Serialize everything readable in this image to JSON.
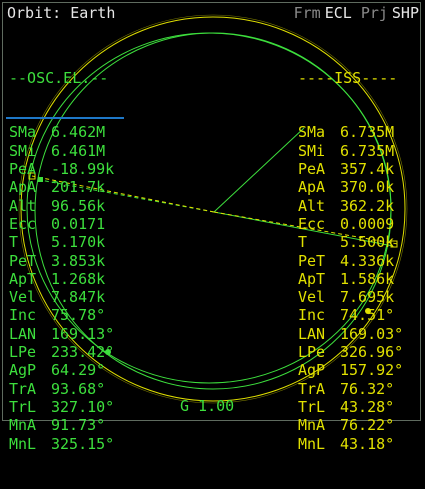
{
  "header": {
    "title": "Orbit: Earth",
    "frm_label": "Frm",
    "frm_value": "ECL",
    "prj_label": "Prj",
    "prj_value": "SHP"
  },
  "left_panel": {
    "section": "--OSC.EL.--",
    "rows": [
      {
        "label": "SMa",
        "value": "6.462M"
      },
      {
        "label": "SMi",
        "value": "6.461M"
      },
      {
        "label": "PeA",
        "value": "-18.99k"
      },
      {
        "label": "ApA",
        "value": "201.7k"
      },
      {
        "label": "Alt",
        "value": "96.56k"
      },
      {
        "label": "Ecc",
        "value": "0.0171"
      },
      {
        "label": "T",
        "value": "5.170k"
      },
      {
        "label": "PeT",
        "value": "3.853k"
      },
      {
        "label": "ApT",
        "value": "1.268k"
      },
      {
        "label": "Vel",
        "value": "7.847k"
      },
      {
        "label": "Inc",
        "value": "75.78°"
      },
      {
        "label": "LAN",
        "value": "169.13°"
      },
      {
        "label": "LPe",
        "value": "233.42°"
      },
      {
        "label": "AgP",
        "value": "64.29°"
      },
      {
        "label": "TrA",
        "value": "93.68°"
      },
      {
        "label": "TrL",
        "value": "327.10°"
      },
      {
        "label": "MnA",
        "value": "91.73°"
      },
      {
        "label": "MnL",
        "value": "325.15°"
      }
    ]
  },
  "right_panel": {
    "section": "----ISS----",
    "rows": [
      {
        "label": "SMa",
        "value": "6.735M"
      },
      {
        "label": "SMi",
        "value": "6.735M"
      },
      {
        "label": "PeA",
        "value": "357.4k"
      },
      {
        "label": "ApA",
        "value": "370.0k"
      },
      {
        "label": "Alt",
        "value": "362.2k"
      },
      {
        "label": "Ecc",
        "value": "0.0009"
      },
      {
        "label": "T",
        "value": "5.500k"
      },
      {
        "label": "PeT",
        "value": "4.336k"
      },
      {
        "label": "ApT",
        "value": "1.586k"
      },
      {
        "label": "Vel",
        "value": "7.695k"
      },
      {
        "label": "Inc",
        "value": "74.51°"
      },
      {
        "label": "LAN",
        "value": "169.03°"
      },
      {
        "label": "LPe",
        "value": "326.96°"
      },
      {
        "label": "AgP",
        "value": "157.92°"
      },
      {
        "label": "TrA",
        "value": "76.32°"
      },
      {
        "label": "TrL",
        "value": "43.28°"
      },
      {
        "label": "MnA",
        "value": "76.22°"
      },
      {
        "label": "MnL",
        "value": "43.18°"
      }
    ]
  },
  "footer": {
    "g_scale": "G 1.00"
  },
  "colors": {
    "own_orbit": "#3ddf3d",
    "target_orbit": "#e0e000",
    "planet": "#3ddf3d",
    "highlight_underline": "#1e78c8",
    "header_text": "#e6e6e6",
    "header_dim": "#8a8a8a"
  }
}
